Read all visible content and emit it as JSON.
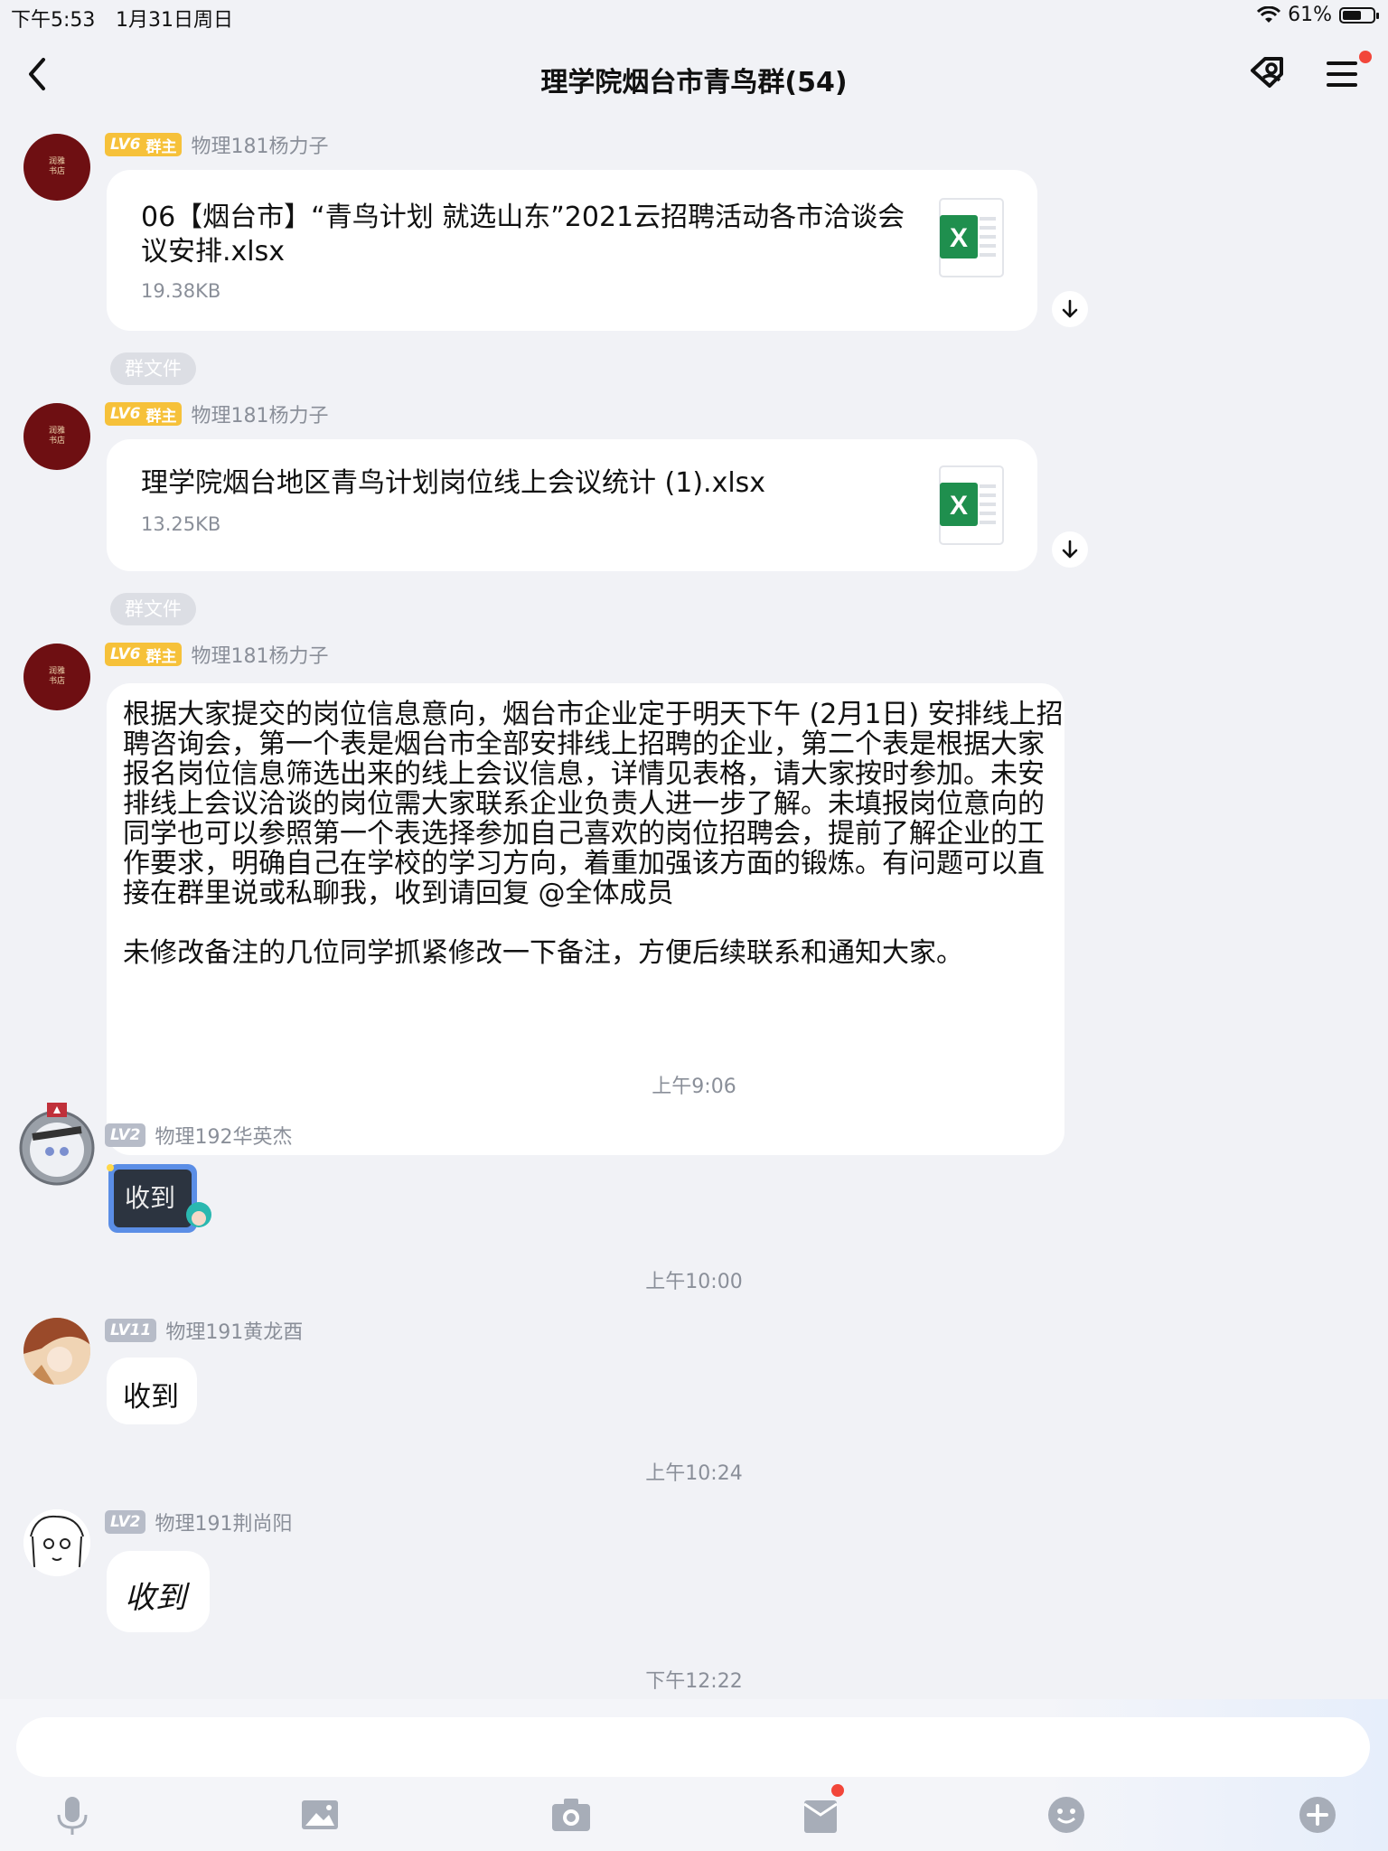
{
  "status_bar": {
    "time": "下午5:53",
    "date": "1月31日周日",
    "battery_percent": "61%",
    "battery_level": 0.61
  },
  "header": {
    "title": "理学院烟台市青鸟群(54)",
    "back_icon": "chevron-left-icon",
    "icons": [
      "contact-share-icon",
      "menu-icon"
    ]
  },
  "messages": {
    "m1": {
      "level": "LV6",
      "role": "群主",
      "sender": "物理181杨力子",
      "file_name": "06【烟台市】“青鸟计划 就选山东”2021云招聘活动各市洽谈会议安排.xlsx",
      "file_size": "19.38KB",
      "tag": "群文件"
    },
    "m2": {
      "level": "LV6",
      "role": "群主",
      "sender": "物理181杨力子",
      "file_name": "理学院烟台地区青鸟计划岗位线上会议统计 (1).xlsx",
      "file_size": "13.25KB",
      "tag": "群文件"
    },
    "m3": {
      "level": "LV6",
      "role": "群主",
      "sender": "物理181杨力子",
      "text": "根据大家提交的岗位信息意向，烟台市企业定于明天下午 (2月1日) 安排线上招聘咨询会，第一个表是烟台市全部安排线上招聘的企业，第二个表是根据大家报名岗位信息筛选出来的线上会议信息，详情见表格，请大家按时参加。未安排线上会议洽谈的岗位需大家联系企业负责人进一步了解。未填报岗位意向的同学也可以参照第一个表选择参加自己喜欢的岗位招聘会，提前了解企业的工作要求，明确自己在学校的学习方向，着重加强该方面的锻炼。有问题可以直接在群里说或私聊我，收到请回复 @全体成员\n\n未修改备注的几位同学抓紧修改一下备注，方便后续联系和通知大家。"
    },
    "t1": "上午9:06",
    "m4": {
      "level": "LV2",
      "sender": "物理192华英杰",
      "sticker_text": "收到"
    },
    "t2": "上午10:00",
    "m5": {
      "level": "LV11",
      "sender": "物理191黄龙酉",
      "text": "收到"
    },
    "t3": "上午10:24",
    "m6": {
      "level": "LV2",
      "sender": "物理191荆尚阳",
      "handwritten_text": "收到"
    },
    "t4": "下午12:22"
  },
  "input": {
    "placeholder": ""
  },
  "toolbar": {
    "icons": [
      "microphone-icon",
      "image-icon",
      "camera-icon",
      "red-packet-icon",
      "emoji-icon",
      "plus-icon"
    ]
  },
  "colors": {
    "background": "#f1f2f6",
    "owner_badge": "#f6c13a",
    "level_badge": "#b7bcc8",
    "excel_green": "#1f8f4e",
    "notification_red": "#f2463a"
  }
}
